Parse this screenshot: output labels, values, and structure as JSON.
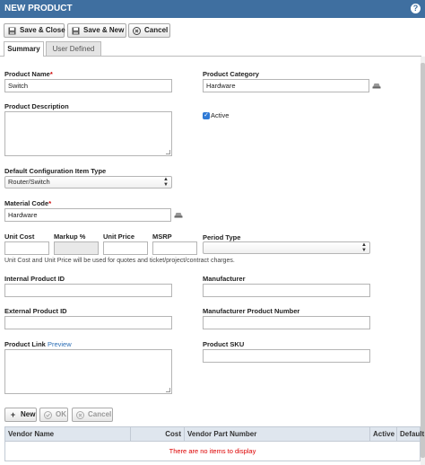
{
  "window": {
    "title": "NEW PRODUCT",
    "help_glyph": "?"
  },
  "toolbar": {
    "save_close": "Save & Close",
    "save_new": "Save & New",
    "cancel": "Cancel"
  },
  "tabs": {
    "summary": "Summary",
    "user_defined": "User Defined"
  },
  "form": {
    "product_name": {
      "label": "Product Name",
      "required": "*",
      "value": "Switch"
    },
    "product_category": {
      "label": "Product Category",
      "value": "Hardware"
    },
    "product_description": {
      "label": "Product Description",
      "value": ""
    },
    "active": {
      "label": "Active",
      "checked": true
    },
    "default_ci_type": {
      "label": "Default Configuration Item Type",
      "value": "Router/Switch"
    },
    "material_code": {
      "label": "Material Code",
      "required": "*",
      "value": "Hardware"
    },
    "unit_cost": {
      "label": "Unit Cost",
      "value": ""
    },
    "markup_pct": {
      "label": "Markup %",
      "value": ""
    },
    "unit_price": {
      "label": "Unit Price",
      "value": ""
    },
    "msrp": {
      "label": "MSRP",
      "value": ""
    },
    "period_type": {
      "label": "Period Type",
      "value": ""
    },
    "price_note": "Unit Cost and Unit Price will be used for quotes and ticket/project/contract charges.",
    "internal_product_id": {
      "label": "Internal Product ID",
      "value": ""
    },
    "manufacturer": {
      "label": "Manufacturer",
      "value": ""
    },
    "external_product_id": {
      "label": "External Product ID",
      "value": ""
    },
    "manufacturer_product_number": {
      "label": "Manufacturer Product Number",
      "value": ""
    },
    "product_link": {
      "label": "Product Link",
      "preview": "Preview",
      "value": ""
    },
    "product_sku": {
      "label": "Product SKU",
      "value": ""
    }
  },
  "vendor_toolbar": {
    "new": "New",
    "ok": "OK",
    "cancel": "Cancel"
  },
  "vendor_grid": {
    "columns": [
      "Vendor Name",
      "Cost",
      "Vendor Part Number",
      "Active",
      "Default"
    ],
    "empty_message": "There are no items to display"
  },
  "colors": {
    "title_bar": "#3f6fa0",
    "required": "#cc0000",
    "link": "#2a6db5",
    "empty_message": "#dd0000",
    "checkbox": "#2f7ad6"
  }
}
